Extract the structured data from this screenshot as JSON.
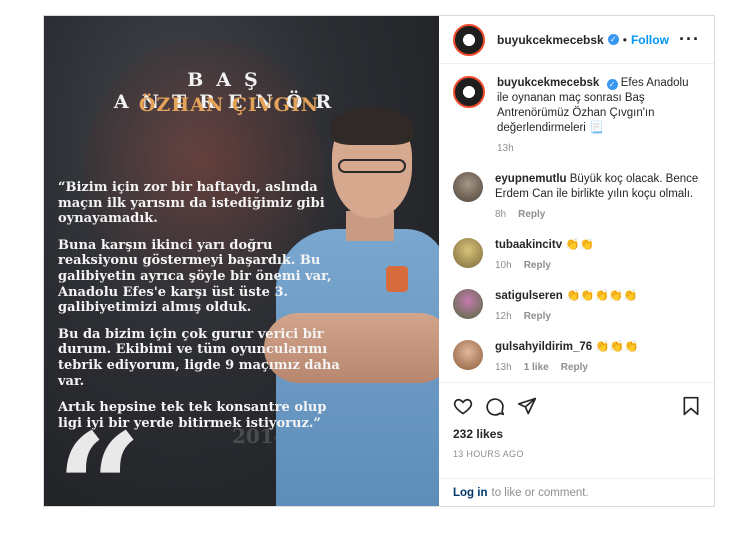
{
  "post": {
    "image": {
      "title_line1": "BAŞ ANTRENÖR",
      "title_line2": "ÖZHAN ÇIVGIN",
      "quote_paragraphs": [
        "“Bizim için zor bir haftaydı, aslında maçın ilk yarısını da istediğimiz gibi oynayamadık.",
        "Buna karşın ikinci yarı doğru reaksiyonu göstermeyi başardık. Bu galibiyetin ayrıca şöyle bir önemi var, Anadolu Efes'e karşı üst üste 3. galibiyetimizi almış olduk.",
        "Bu da bizim için çok gurur verici bir durum. Ekibimi ve tüm oyuncularımı tebrik ediyorum, ligde 9 maçımız daha var.",
        "Artık hepsine tek tek konsantre olup ligi iyi bir yerde bitirmek istiyoruz.”"
      ],
      "quote_mark": "“",
      "year_mark": "2014"
    },
    "header": {
      "username": "buyukcekmecebsk",
      "verified_icon": "✓",
      "separator": "•",
      "follow_label": "Follow",
      "more_icon": "···"
    },
    "caption": {
      "username": "buyukcekmecebsk",
      "text": "Efes Anadolu ile oynanan maç sonrası Baş Antrenörümüz Özhan Çıvgın'ın değerlendirmeleri 📃",
      "time": "13h"
    },
    "comments": [
      {
        "username": "eyupnemutlu",
        "text": "Büyük koç olacak. Bence Erdem Can ile birlikte yılın koçu olmalı.",
        "time": "8h",
        "likes": "",
        "reply": "Reply"
      },
      {
        "username": "tubaakincitv",
        "text": "👏👏",
        "time": "10h",
        "likes": "",
        "reply": "Reply"
      },
      {
        "username": "satigulseren",
        "text": "👏👏👏👏👏",
        "time": "12h",
        "likes": "",
        "reply": "Reply"
      },
      {
        "username": "gulsahyildirim_76",
        "text": "👏👏👏",
        "time": "13h",
        "likes": "1 like",
        "reply": "Reply"
      }
    ],
    "likes": "232 likes",
    "timestamp": "13 HOURS AGO",
    "login": {
      "link": "Log in",
      "text": "to like or comment."
    }
  }
}
